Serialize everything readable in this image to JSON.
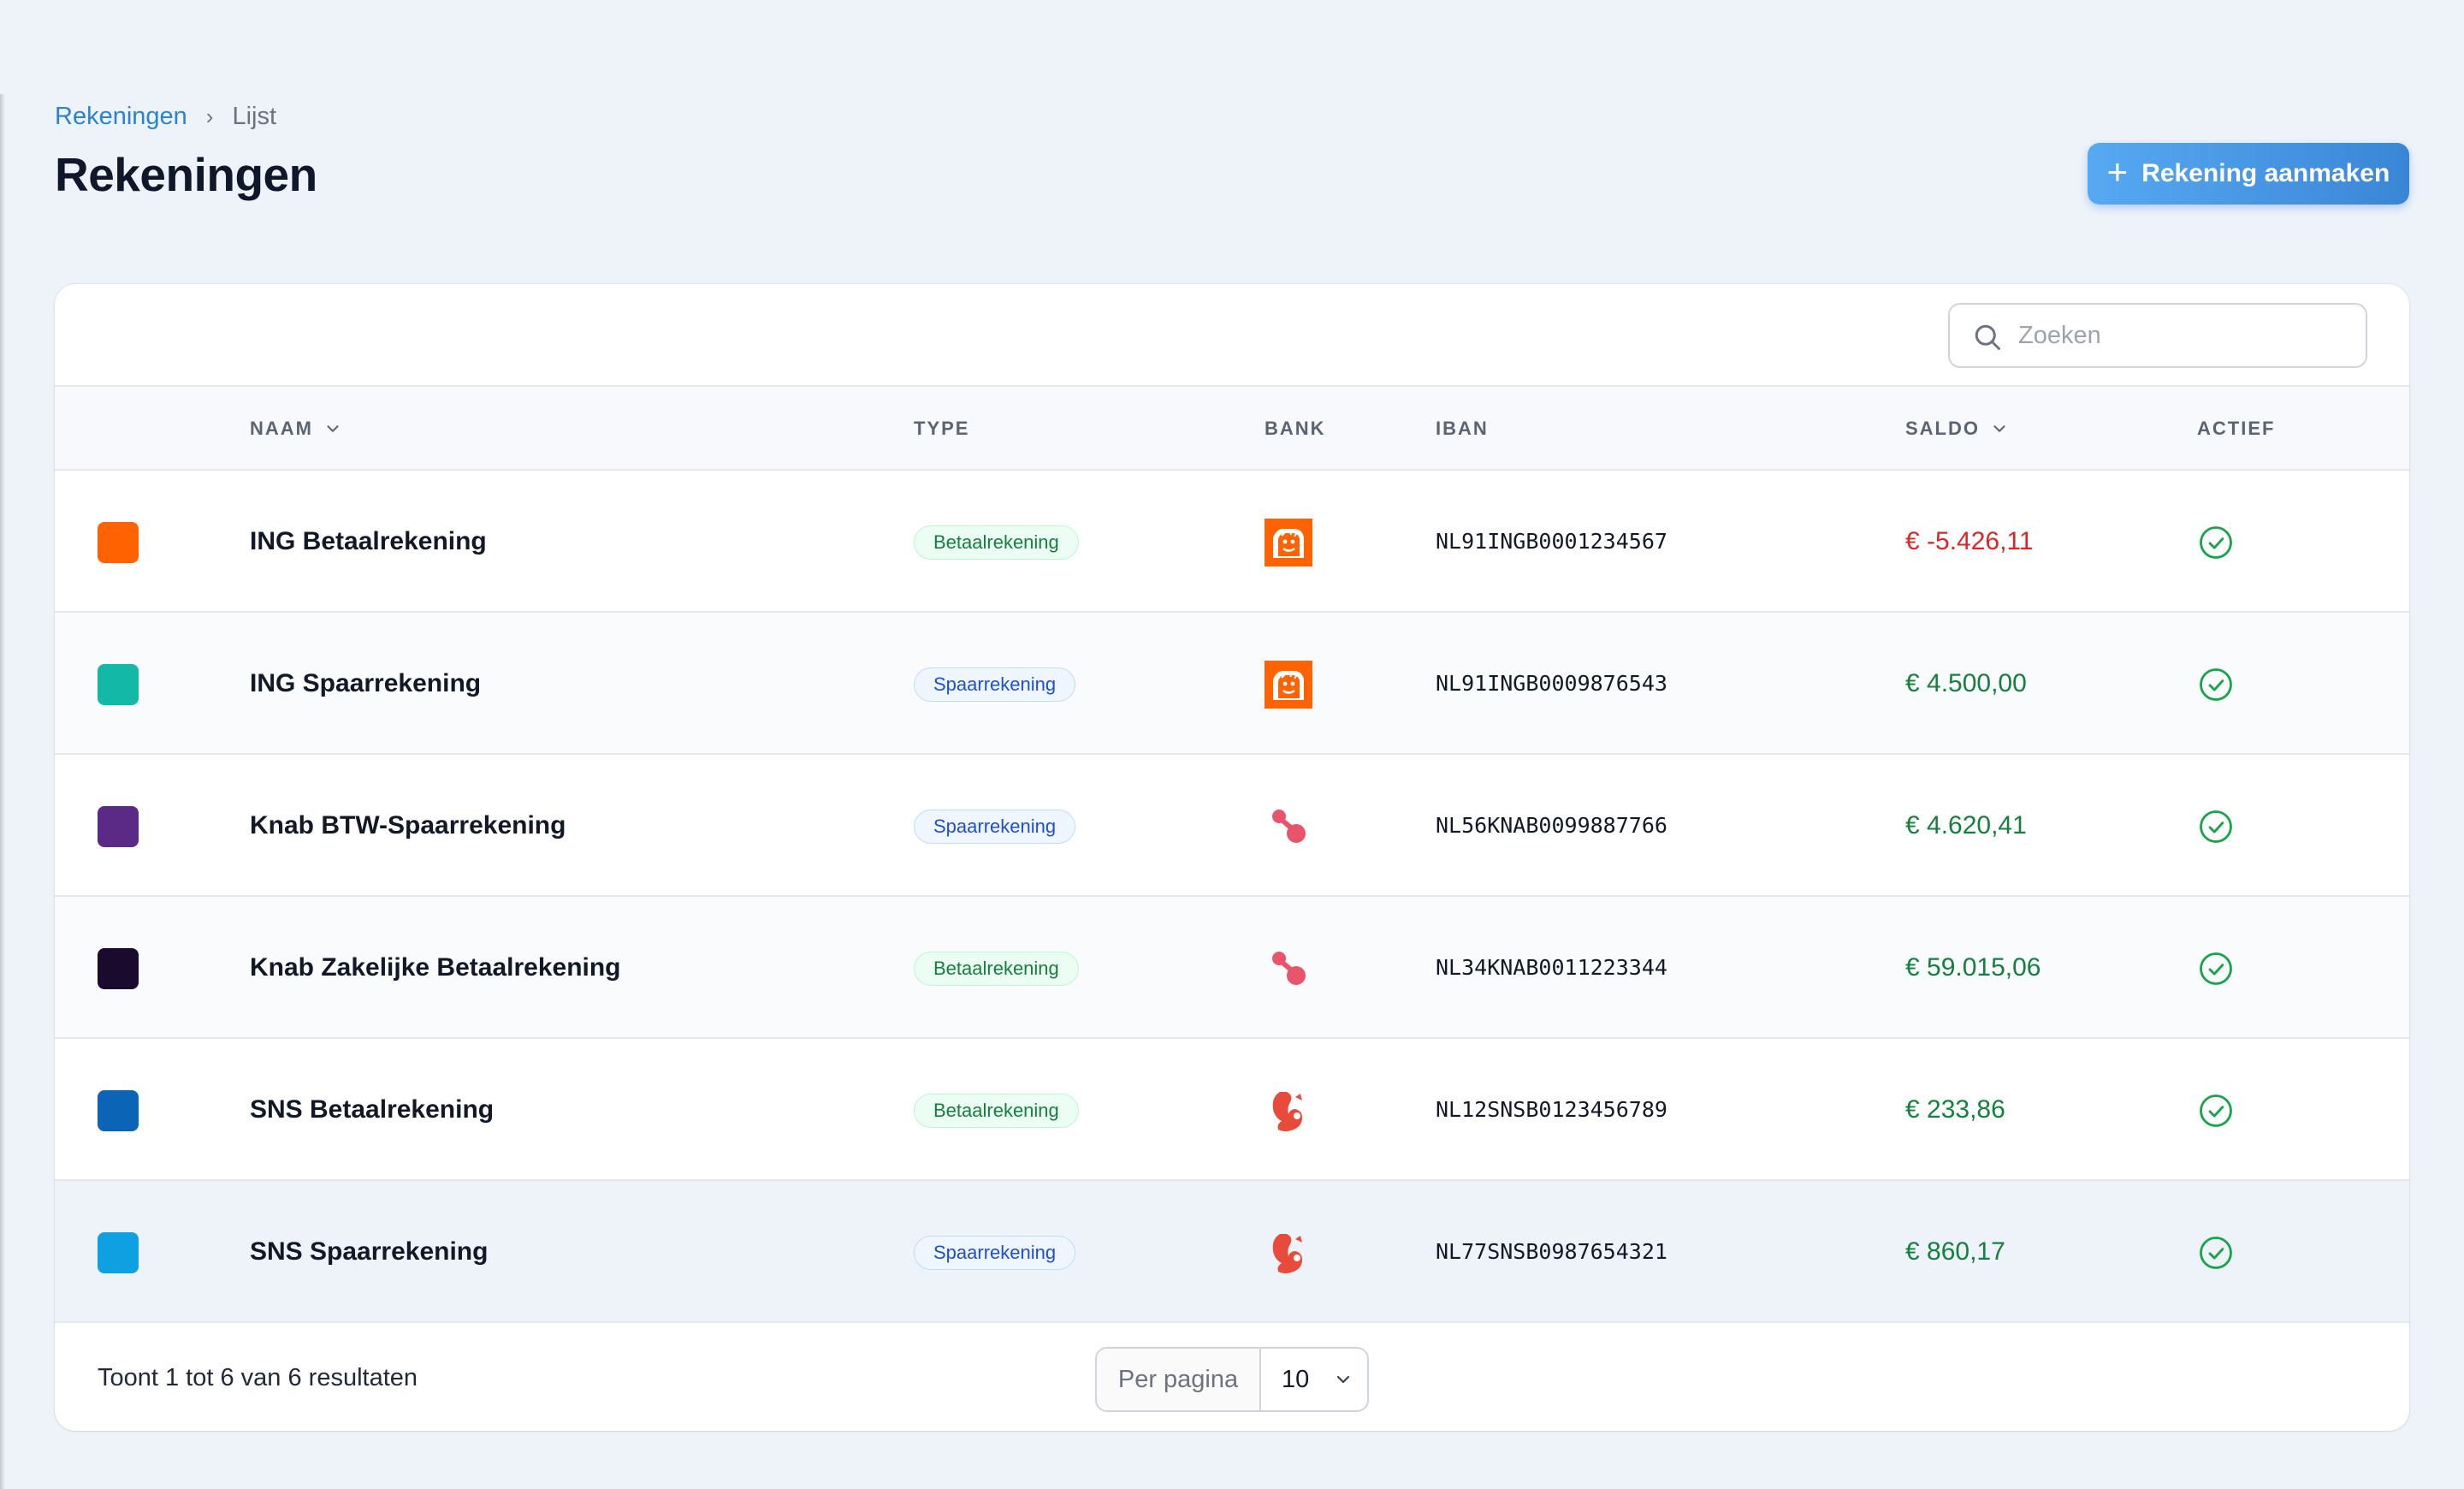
{
  "breadcrumb": {
    "parent": "Rekeningen",
    "separator": "›",
    "current": "Lijst"
  },
  "page": {
    "title": "Rekeningen"
  },
  "actions": {
    "create_label": "Rekening aanmaken",
    "create_icon": "plus-icon"
  },
  "search": {
    "placeholder": "Zoeken",
    "value": ""
  },
  "table": {
    "columns": {
      "name": "NAAM",
      "type": "TYPE",
      "bank": "BANK",
      "iban": "IBAN",
      "balance": "SALDO",
      "active": "ACTIEF"
    },
    "sortable_columns": [
      "NAAM",
      "SALDO"
    ],
    "rows": [
      {
        "color": "#ff6200",
        "name": "ING Betaalrekening",
        "type": "Betaalrekening",
        "bank": "ing-lion-logo",
        "iban": "NL91INGB0001234567",
        "balance": "€ -5.426,11",
        "active": true
      },
      {
        "color": "#14b8a6",
        "name": "ING Spaarrekening",
        "type": "Spaarrekening",
        "bank": "ing-lion-logo",
        "iban": "NL91INGB0009876543",
        "balance": "€ 4.500,00",
        "active": true
      },
      {
        "color": "#5b2a86",
        "name": "Knab BTW-Spaarrekening",
        "type": "Spaarrekening",
        "bank": "knab-logo",
        "iban": "NL56KNAB0099887766",
        "balance": "€ 4.620,41",
        "active": true
      },
      {
        "color": "#1a0a2e",
        "name": "Knab Zakelijke Betaalrekening",
        "type": "Betaalrekening",
        "bank": "knab-logo",
        "iban": "NL34KNAB0011223344",
        "balance": "€ 59.015,06",
        "active": true
      },
      {
        "color": "#0b64b5",
        "name": "SNS Betaalrekening",
        "type": "Betaalrekening",
        "bank": "sns-squirrel-logo",
        "iban": "NL12SNSB0123456789",
        "balance": "€ 233,86",
        "active": true
      },
      {
        "color": "#0ea0e0",
        "name": "SNS Spaarrekening",
        "type": "Spaarrekening",
        "bank": "sns-squirrel-logo",
        "iban": "NL77SNSB0987654321",
        "balance": "€ 860,17",
        "active": true
      }
    ]
  },
  "footer": {
    "result_text": "Toont 1 tot 6 van 6 resultaten",
    "per_page_label": "Per pagina",
    "per_page_value": "10"
  },
  "colors": {
    "accent": "#3b8ee0",
    "negative": "#dc2626",
    "positive": "#15803d",
    "ing_orange": "#ff6200",
    "knab_pink": "#e8546a",
    "sns_red": "#e84a3c"
  }
}
